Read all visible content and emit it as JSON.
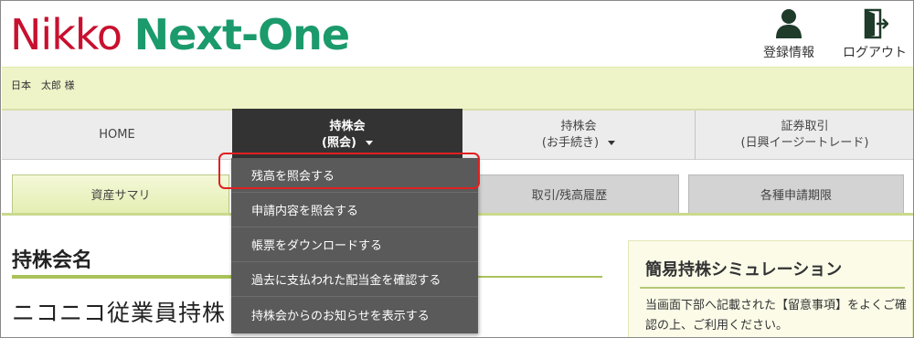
{
  "header": {
    "logo_part1": "Nikko ",
    "logo_part2": "Next-One",
    "register_label": "登録情報",
    "logout_label": "ログアウト",
    "register_icon": "user-icon",
    "logout_icon": "logout-door-icon"
  },
  "user": {
    "name": "日本　太郎 様"
  },
  "nav": {
    "home": "HOME",
    "inquiry_line1": "持株会",
    "inquiry_line2": "(照会)",
    "procedure_line1": "持株会",
    "procedure_line2": "(お手続き)",
    "securities_line1": "証券取引",
    "securities_line2": "(日興イージートレード)"
  },
  "tabs": {
    "summary": "資産サマリ",
    "history": "取引/残高履歴",
    "apply_period": "各種申請期限"
  },
  "dropdown": {
    "items": [
      "残高を照会する",
      "申請内容を照会する",
      "帳票をダウンロードする",
      "過去に支払われた配当金を確認する",
      "持株会からのお知らせを表示する"
    ]
  },
  "main": {
    "section_title": "持株会名",
    "company_name": "ニコニコ従業員持株"
  },
  "simulation": {
    "title": "簡易持株シミュレーション",
    "text": "当画面下部へ記載された【留意事項】をよくご確認の上、ご利用ください。"
  },
  "colors": {
    "logo_red": "#c8102e",
    "logo_green": "#1b9a6c",
    "nav_active": "#333333",
    "dropdown_bg": "#5a5a5a",
    "highlight": "#e02020"
  }
}
